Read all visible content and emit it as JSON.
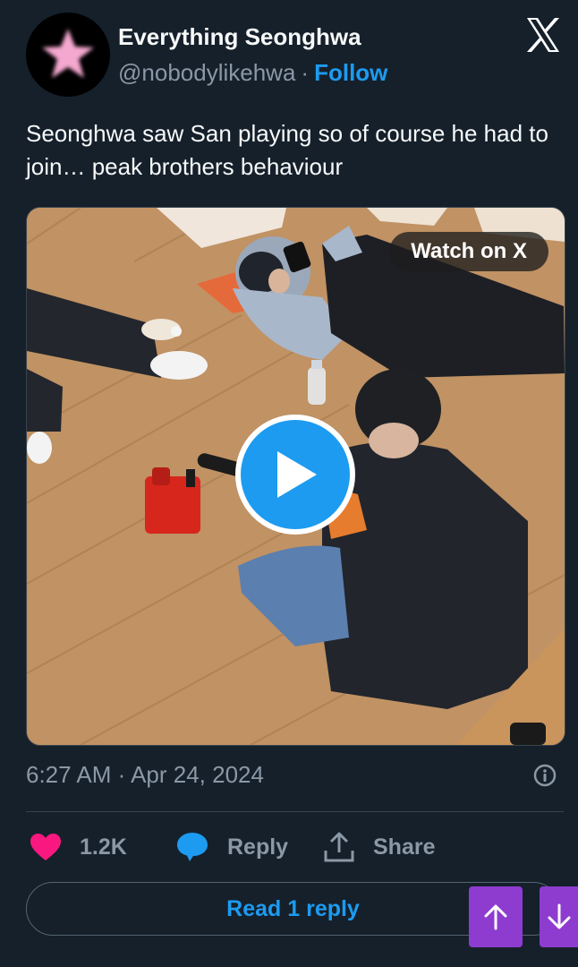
{
  "author": {
    "display_name": "Everything Seonghwa",
    "handle": "@nobodylikehwa",
    "separator": "·",
    "follow_label": "Follow"
  },
  "tweet": {
    "text": "Seonghwa saw San playing so of course he had to join… peak brothers behaviour"
  },
  "media": {
    "watch_label": "Watch on X"
  },
  "meta": {
    "timestamp": "6:27 AM · Apr 24, 2024"
  },
  "actions": {
    "likes": "1.2K",
    "reply_label": "Reply",
    "share_label": "Share"
  },
  "read_replies_label": "Read 1 reply",
  "icons": {
    "avatar": "pink-star-avatar",
    "logo": "x-logo-icon",
    "like": "heart-icon",
    "reply": "speech-bubble-icon",
    "share": "share-upload-icon",
    "info": "info-icon",
    "up": "arrow-up-icon",
    "down": "arrow-down-icon"
  },
  "colors": {
    "background": "#15202b",
    "accent": "#1d9bf0",
    "like": "#f91880",
    "scroll_buttons": "#8e3ccf"
  }
}
